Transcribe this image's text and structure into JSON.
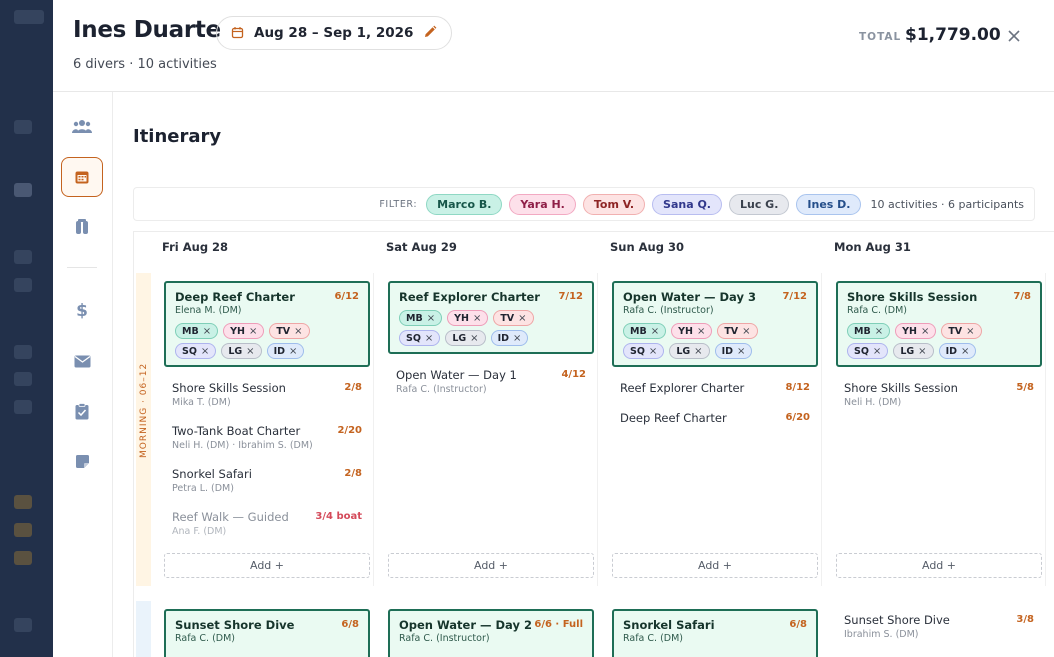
{
  "header": {
    "name": "Ines Duarte",
    "subtitle": "6 divers · 10 activities",
    "date_range": "Aug 28 – Sep 1, 2026",
    "total_label": "TOTAL",
    "total_value": "$1,779.00"
  },
  "rail": [
    "people-icon",
    "calendar-icon",
    "gear-icon",
    "dollar-icon",
    "mail-icon",
    "clipboard-icon",
    "note-icon"
  ],
  "itinerary": {
    "title": "Itinerary",
    "filter_label": "FILTER:",
    "filters": [
      {
        "label": "Marco B.",
        "bg": "#c9f1e6",
        "fg": "#17574a",
        "border": "#8fd8c4"
      },
      {
        "label": "Yara H.",
        "bg": "#fde0ea",
        "fg": "#8f1f48",
        "border": "#f2a9c2"
      },
      {
        "label": "Tom V.",
        "bg": "#fde3e3",
        "fg": "#8e2424",
        "border": "#f1b0b0"
      },
      {
        "label": "Sana Q.",
        "bg": "#e3e5fb",
        "fg": "#31388c",
        "border": "#b8bdf0"
      },
      {
        "label": "Luc G.",
        "bg": "#e7e9ee",
        "fg": "#3a414d",
        "border": "#c3c8d1"
      },
      {
        "label": "Ines D.",
        "bg": "#dfeafb",
        "fg": "#244e8a",
        "border": "#a9c4ee"
      }
    ],
    "summary": "10 activities · 6 participants",
    "morning_label": "MORNING · 06–12",
    "add_label": "Add +",
    "chip_colors": {
      "MB": {
        "bg": "#c9f1e6",
        "border": "#7fcfb8"
      },
      "YH": {
        "bg": "#fde0ea",
        "border": "#ee9db9"
      },
      "TV": {
        "bg": "#fde3e3",
        "border": "#eea6a6"
      },
      "SQ": {
        "bg": "#e3e5fb",
        "border": "#aeb4ee"
      },
      "LG": {
        "bg": "#e7e9ee",
        "border": "#b8bec9"
      },
      "ID": {
        "bg": "#dfeafb",
        "border": "#9fbdec"
      }
    },
    "days": [
      {
        "header": "Fri Aug 28",
        "featured": {
          "title": "Deep Reef Charter",
          "sub": "Elena M. (DM)",
          "cap": "6/12",
          "chips": [
            "MB",
            "YH",
            "TV",
            "SQ",
            "LG",
            "ID"
          ]
        },
        "activities": [
          {
            "title": "Shore Skills Session",
            "sub": "Mika T. (DM)",
            "cap": "2/8",
            "dim": false
          },
          {
            "title": "Two-Tank Boat Charter",
            "sub": "Neli H. (DM) · Ibrahim S. (DM)",
            "cap": "2/20",
            "dim": false
          },
          {
            "title": "Snorkel Safari",
            "sub": "Petra L. (DM)",
            "cap": "2/8",
            "dim": false
          },
          {
            "title": "Reef Walk — Guided",
            "sub": "Ana F. (DM)",
            "cap": "3/4 boat",
            "dim": true
          }
        ],
        "afternoon": {
          "title": "Sunset Shore Dive",
          "sub": "Rafa C. (DM)",
          "cap": "6/8",
          "featured": true
        }
      },
      {
        "header": "Sat Aug 29",
        "featured": {
          "title": "Reef Explorer Charter",
          "sub": "",
          "cap": "7/12",
          "chips": [
            "MB",
            "YH",
            "TV",
            "SQ",
            "LG",
            "ID"
          ]
        },
        "activities": [
          {
            "title": "Open Water — Day 1",
            "sub": "Rafa C. (Instructor)",
            "cap": "4/12",
            "dim": false
          }
        ],
        "afternoon": {
          "title": "Open Water — Day 2",
          "sub": "Rafa C. (Instructor)",
          "cap": "6/6 · Full",
          "featured": true
        }
      },
      {
        "header": "Sun Aug 30",
        "featured": {
          "title": "Open Water — Day 3",
          "sub": "Rafa C. (Instructor)",
          "cap": "7/12",
          "chips": [
            "MB",
            "YH",
            "TV",
            "SQ",
            "LG",
            "ID"
          ]
        },
        "activities": [
          {
            "title": "Reef Explorer Charter",
            "sub": "",
            "cap": "8/12",
            "dim": false
          },
          {
            "title": "Deep Reef Charter",
            "sub": "",
            "cap": "6/20",
            "dim": false
          }
        ],
        "afternoon": {
          "title": "Snorkel Safari",
          "sub": "Rafa C. (DM)",
          "cap": "6/8",
          "featured": true
        }
      },
      {
        "header": "Mon Aug 31",
        "featured": {
          "title": "Shore Skills Session",
          "sub": "Rafa C. (DM)",
          "cap": "7/8",
          "chips": [
            "MB",
            "YH",
            "TV",
            "SQ",
            "LG",
            "ID"
          ]
        },
        "activities": [
          {
            "title": "Shore Skills Session",
            "sub": "Neli H. (DM)",
            "cap": "5/8",
            "dim": false
          }
        ],
        "afternoon": {
          "title": "Sunset Shore Dive",
          "sub": "Ibrahim S. (DM)",
          "cap": "3/8",
          "featured": false
        }
      }
    ]
  }
}
